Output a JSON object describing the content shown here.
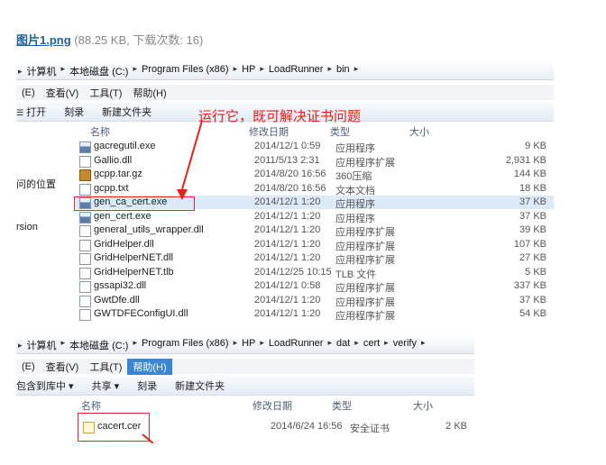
{
  "caption": {
    "file": "图片1.png",
    "meta": "(88.25 KB, 下载次数: 16)"
  },
  "top": {
    "address": [
      "计算机",
      "本地磁盘 (C:)",
      "Program Files (x86)",
      "HP",
      "LoadRunner",
      "bin"
    ],
    "menu": [
      "(E)",
      "查看(V)",
      "工具(T)",
      "帮助(H)"
    ],
    "toolbar": [
      "打开",
      "刻录",
      "新建文件夹"
    ],
    "annotation": "运行它，既可解决证书问题",
    "nav": [
      "问的位置",
      "rsion"
    ],
    "columns": {
      "name": "名称",
      "date": "修改日期",
      "type": "类型",
      "size": "大小"
    },
    "files": [
      {
        "icon": "exe",
        "name": "gacregutil.exe",
        "date": "2014/12/1 0:59",
        "type": "应用程序",
        "size": "9 KB"
      },
      {
        "icon": "dll",
        "name": "Gallio.dll",
        "date": "2011/5/13 2:31",
        "type": "应用程序扩展",
        "size": "2,931 KB"
      },
      {
        "icon": "zip",
        "name": "gcpp.tar.gz",
        "date": "2014/8/20 16:56",
        "type": "360压缩",
        "size": "144 KB"
      },
      {
        "icon": "doc",
        "name": "gcpp.txt",
        "date": "2014/8/20 16:56",
        "type": "文本文档",
        "size": "18 KB"
      },
      {
        "icon": "exe",
        "name": "gen_ca_cert.exe",
        "date": "2014/12/1 1:20",
        "type": "应用程序",
        "size": "37 KB",
        "selected": true
      },
      {
        "icon": "exe",
        "name": "gen_cert.exe",
        "date": "2014/12/1 1:20",
        "type": "应用程序",
        "size": "37 KB"
      },
      {
        "icon": "dll",
        "name": "general_utils_wrapper.dll",
        "date": "2014/12/1 1:20",
        "type": "应用程序扩展",
        "size": "39 KB"
      },
      {
        "icon": "dll",
        "name": "GridHelper.dll",
        "date": "2014/12/1 1:20",
        "type": "应用程序扩展",
        "size": "107 KB"
      },
      {
        "icon": "dll",
        "name": "GridHelperNET.dll",
        "date": "2014/12/1 1:20",
        "type": "应用程序扩展",
        "size": "27 KB"
      },
      {
        "icon": "doc",
        "name": "GridHelperNET.tlb",
        "date": "2014/12/25 10:15",
        "type": "TLB 文件",
        "size": "5 KB"
      },
      {
        "icon": "dll",
        "name": "gssapi32.dll",
        "date": "2014/12/1 0:58",
        "type": "应用程序扩展",
        "size": "337 KB"
      },
      {
        "icon": "dll",
        "name": "GwtDfe.dll",
        "date": "2014/12/1 1:20",
        "type": "应用程序扩展",
        "size": "37 KB"
      },
      {
        "icon": "dll",
        "name": "GWTDFEConfigUI.dll",
        "date": "2014/12/1 1:20",
        "type": "应用程序扩展",
        "size": "54 KB"
      }
    ]
  },
  "bottom": {
    "address": [
      "计算机",
      "本地磁盘 (C:)",
      "Program Files (x86)",
      "HP",
      "LoadRunner",
      "dat",
      "cert",
      "verify"
    ],
    "menu": [
      "(E)",
      "查看(V)",
      "工具(T)",
      "帮助(H)"
    ],
    "toolbar": [
      "包含到库中 ▾",
      "共享 ▾",
      "刻录",
      "新建文件夹"
    ],
    "columns": {
      "name": "名称",
      "date": "修改日期",
      "type": "类型",
      "size": "大小"
    },
    "files": [
      {
        "icon": "cer",
        "name": "cacert.cer",
        "date": "2014/6/24 16:56",
        "type": "安全证书",
        "size": "2 KB"
      }
    ]
  }
}
